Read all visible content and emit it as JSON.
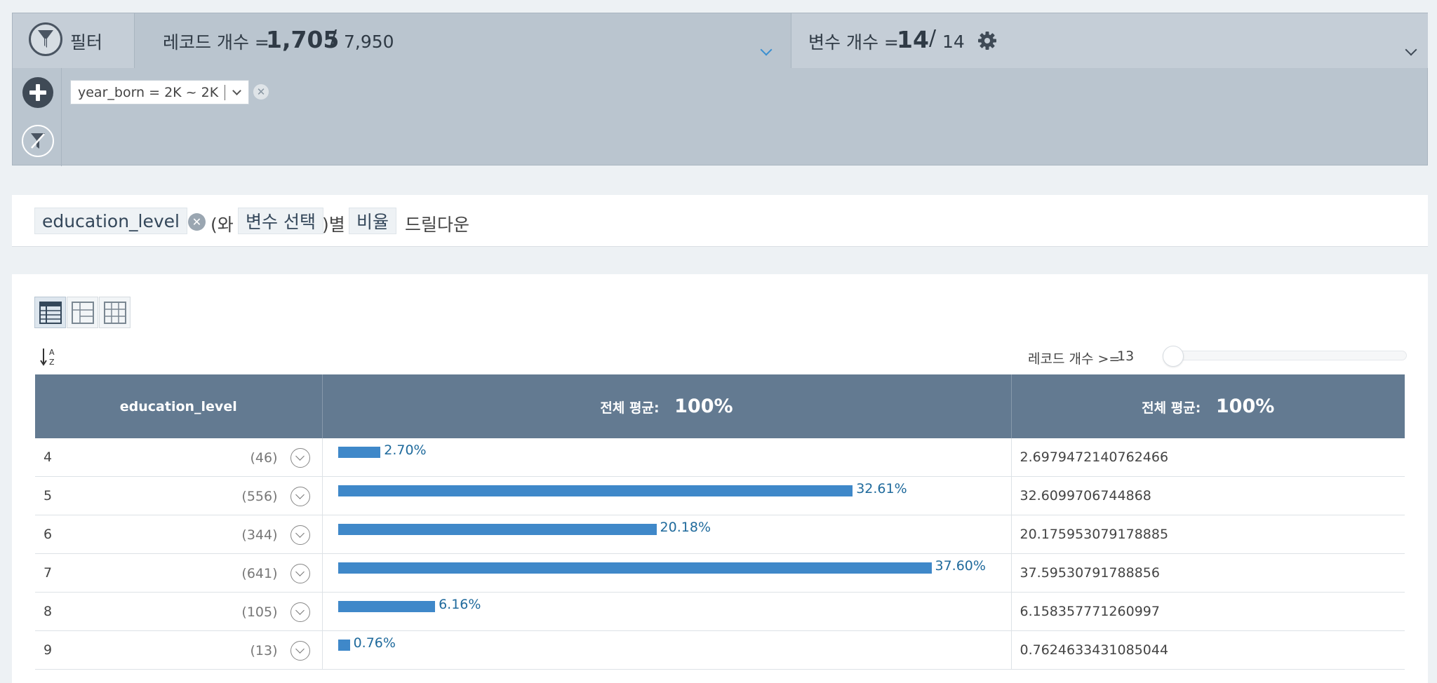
{
  "filter_panel": {
    "label": "필터",
    "records": {
      "label": "레코드 개수 =",
      "filtered": "1,705",
      "slash": "/",
      "total": "7,950"
    },
    "variables": {
      "label": "변수 개수 =",
      "selected": "14",
      "slash": "/",
      "total": "14"
    },
    "active_filter": {
      "text": "year_born = 2K ~ 2K"
    }
  },
  "query": {
    "variable": "education_level",
    "text_with": "(와",
    "variable_select": "변수 선택",
    "text_by": ")별",
    "measure": "비율",
    "text_drilldown": "드릴다운"
  },
  "controls": {
    "threshold_label": "레코드 개수 >=",
    "threshold_value": "13"
  },
  "table": {
    "headers": {
      "col1": "education_level",
      "col2_label": "전체 평균:",
      "col2_value": "100%",
      "col3_label": "전체 평균:",
      "col3_value": "100%"
    },
    "rows": [
      {
        "level": "4",
        "count": "(46)",
        "pct": 2.7,
        "pct_label": "2.70%",
        "value": "2.6979472140762466"
      },
      {
        "level": "5",
        "count": "(556)",
        "pct": 32.61,
        "pct_label": "32.61%",
        "value": "32.6099706744868"
      },
      {
        "level": "6",
        "count": "(344)",
        "pct": 20.18,
        "pct_label": "20.18%",
        "value": "20.175953079178885"
      },
      {
        "level": "7",
        "count": "(641)",
        "pct": 37.6,
        "pct_label": "37.60%",
        "value": "37.59530791788856"
      },
      {
        "level": "8",
        "count": "(105)",
        "pct": 6.16,
        "pct_label": "6.16%",
        "value": "6.158357771260997"
      },
      {
        "level": "9",
        "count": "(13)",
        "pct": 0.76,
        "pct_label": "0.76%",
        "value": "0.7624633431085044"
      }
    ]
  },
  "colors": {
    "bar": "#3f88c9",
    "header_bg": "#637a91",
    "filter_bg": "#bac5cf",
    "accent_chevron": "#3a8fd0"
  }
}
